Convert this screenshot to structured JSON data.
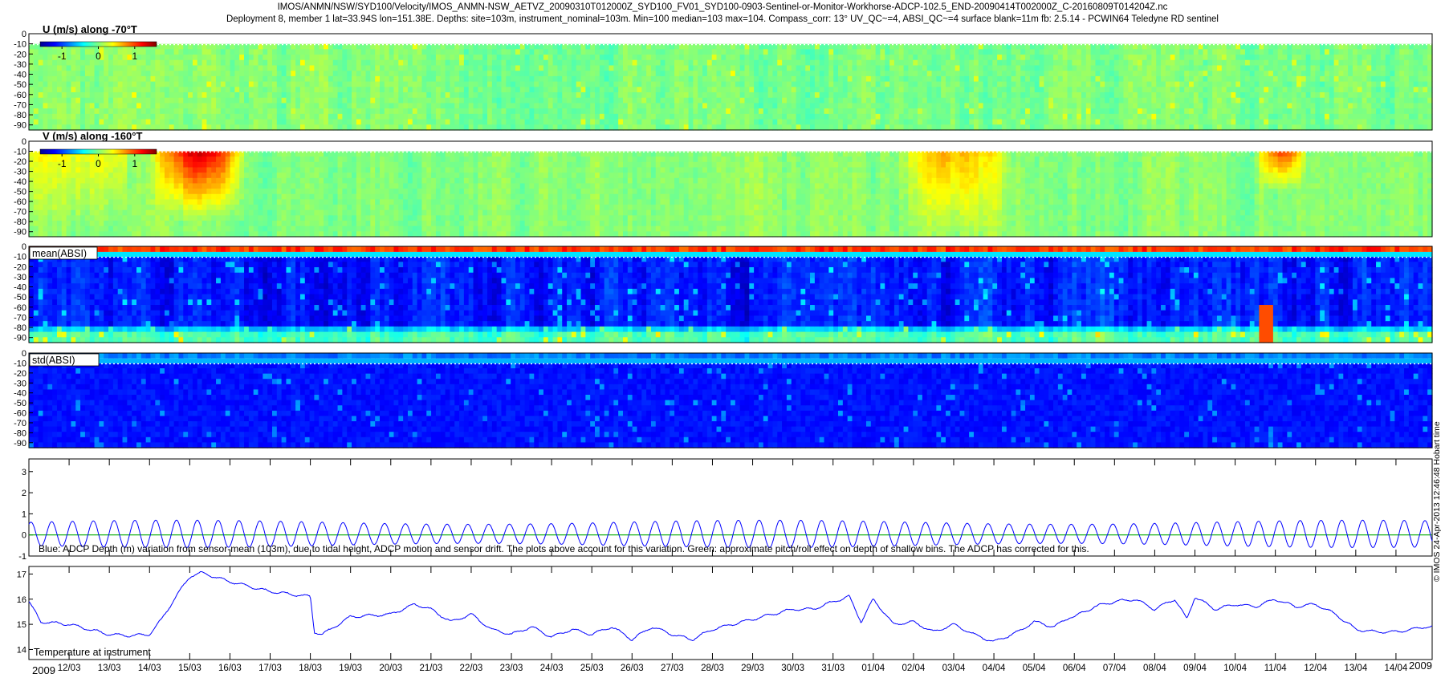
{
  "header": {
    "line1": "IMOS/ANMN/NSW/SYD100/Velocity/IMOS_ANMN-NSW_AETVZ_20090310T012000Z_SYD100_FV01_SYD100-0903-Sentinel-or-Monitor-Workhorse-ADCP-102.5_END-20090414T002000Z_C-20160809T014204Z.nc",
    "line2": "Deployment 8, member 1 lat=33.94S lon=151.38E. Depths: site=103m, instrument_nominal=103m. Min=100 median=103 max=104. Compass_corr: 13° UV_QC~=4, ABSI_QC~=4 surface blank=11m fb: 2.5.14 - PCWIN64 Teledyne RD sentinel"
  },
  "side_label": "© IMOS 24-Apr-2013 12:46:48 Hobart time",
  "colors": {
    "line_blue": "#0000ff",
    "line_green": "#00aa00",
    "jet_dark_blue": "#00008f",
    "jet_green": "#40d040",
    "jet_orange": "#e07000"
  },
  "chart_data": [
    {
      "type": "heatmap",
      "title": "U (m/s) along -70°T",
      "ylim": [
        -95,
        0
      ],
      "yticks": [
        0,
        -10,
        -20,
        -30,
        -40,
        -50,
        -60,
        -70,
        -80,
        -90
      ],
      "colorbar": {
        "colormap": "jet",
        "range": [
          -1.6,
          1.6
        ],
        "ticks": [
          -1,
          0,
          1
        ],
        "tick_labels": [
          "-1",
          "0",
          "1"
        ]
      }
    },
    {
      "type": "heatmap",
      "title": "V (m/s) along -160°T",
      "ylim": [
        -95,
        0
      ],
      "yticks": [
        0,
        -10,
        -20,
        -30,
        -40,
        -50,
        -60,
        -70,
        -80,
        -90
      ],
      "colorbar": {
        "colormap": "jet",
        "range": [
          -1.6,
          1.6
        ],
        "ticks": [
          -1,
          0,
          1
        ],
        "tick_labels": [
          "-1",
          "0",
          "1"
        ]
      },
      "hotspots": [
        {
          "day_from": 3.0,
          "day_to": 5.5,
          "depth_from": -10,
          "depth_to": -60,
          "value": 1.3
        },
        {
          "day_from": 21.5,
          "day_to": 24.5,
          "depth_from": -10,
          "depth_to": -80,
          "value": 0.6
        },
        {
          "day_from": 30.5,
          "day_to": 31.8,
          "depth_from": -10,
          "depth_to": -30,
          "value": 1.0
        }
      ]
    },
    {
      "type": "heatmap",
      "title": "mean(ABSI)",
      "ylim": [
        -95,
        0
      ],
      "yticks": [
        0,
        -10,
        -20,
        -30,
        -40,
        -50,
        -60,
        -70,
        -80,
        -90
      ]
    },
    {
      "type": "heatmap",
      "title": "std(ABSI)",
      "ylim": [
        -95,
        0
      ],
      "yticks": [
        0,
        -10,
        -20,
        -30,
        -40,
        -50,
        -60,
        -70,
        -80,
        -90
      ]
    },
    {
      "type": "line",
      "annotation": "Blue: ADCP Depth (m) variation from sensor-mean (103m), due to tidal height, ADCP motion and sensor drift. The plots above account for this variation. Green: approximate pitch/roll effect on depth of shallow bins. The ADCP has corrected for this.",
      "ylim": [
        -1,
        3.6
      ],
      "yticks": [
        -1,
        0,
        1,
        2,
        3
      ],
      "series": [
        {
          "color": "#0000ff",
          "model": "semi-diurnal tide",
          "amplitude_m": 0.65,
          "offset_m": 0.05,
          "period_days": 0.5175
        },
        {
          "color": "#00aa00",
          "model": "constant",
          "value_m": 0.0
        }
      ]
    },
    {
      "type": "line",
      "annotation": "Temperature at instrument",
      "ylim": [
        13.6,
        17.3
      ],
      "yticks": [
        14,
        15,
        16,
        17
      ],
      "series": [
        {
          "color": "#0000ff",
          "x": [
            0,
            0.3,
            1,
            1.5,
            2,
            2.5,
            3,
            3.3,
            3.7,
            4,
            4.3,
            4.6,
            5,
            5.5,
            6,
            6.5,
            7,
            7.1,
            7.3,
            8,
            9,
            9.6,
            10,
            10.5,
            11,
            11.5,
            12,
            12.5,
            13,
            13.5,
            14,
            14.5,
            15,
            15.5,
            16,
            16.5,
            17,
            17.5,
            18,
            18.5,
            19,
            19.5,
            20,
            20.4,
            20.7,
            21,
            21.5,
            22,
            22.5,
            23,
            23.5,
            24,
            24.3,
            24.6,
            25,
            25.5,
            25.9,
            26,
            26.5,
            27,
            27.5,
            28,
            28.5,
            28.8,
            29,
            29.5,
            30,
            30.5,
            31,
            31.5,
            32,
            32.5,
            33,
            33.5,
            34,
            34.4,
            34.7
          ],
          "y": [
            15.9,
            15.1,
            15.0,
            14.8,
            14.6,
            14.55,
            14.6,
            15.2,
            16.2,
            16.9,
            17.05,
            16.9,
            16.7,
            16.5,
            16.3,
            16.2,
            16.1,
            14.7,
            14.6,
            15.3,
            15.4,
            15.8,
            15.6,
            15.1,
            15.4,
            14.8,
            14.6,
            14.9,
            14.5,
            14.8,
            14.6,
            14.9,
            14.4,
            14.9,
            14.6,
            14.4,
            14.8,
            15.0,
            15.2,
            15.4,
            15.6,
            15.6,
            15.9,
            16.1,
            15.1,
            16.0,
            15.0,
            15.1,
            14.7,
            15.0,
            14.6,
            14.3,
            14.5,
            14.7,
            15.1,
            14.9,
            15.3,
            15.3,
            15.7,
            15.9,
            16.0,
            15.6,
            16.0,
            15.2,
            16.1,
            15.6,
            15.8,
            15.7,
            16.0,
            15.7,
            15.8,
            15.4,
            14.8,
            14.7,
            14.7,
            14.8,
            14.9
          ]
        }
      ]
    }
  ],
  "time_axis": {
    "range_days": [
      0,
      34.9
    ],
    "year_label_left": "2009",
    "year_label_right": "2009",
    "ticks": [
      {
        "day": 1,
        "label": "12/03"
      },
      {
        "day": 2,
        "label": "13/03"
      },
      {
        "day": 3,
        "label": "14/03"
      },
      {
        "day": 4,
        "label": "15/03"
      },
      {
        "day": 5,
        "label": "16/03"
      },
      {
        "day": 6,
        "label": "17/03"
      },
      {
        "day": 7,
        "label": "18/03"
      },
      {
        "day": 8,
        "label": "19/03"
      },
      {
        "day": 9,
        "label": "20/03"
      },
      {
        "day": 10,
        "label": "21/03"
      },
      {
        "day": 11,
        "label": "22/03"
      },
      {
        "day": 12,
        "label": "23/03"
      },
      {
        "day": 13,
        "label": "24/03"
      },
      {
        "day": 14,
        "label": "25/03"
      },
      {
        "day": 15,
        "label": "26/03"
      },
      {
        "day": 16,
        "label": "27/03"
      },
      {
        "day": 17,
        "label": "28/03"
      },
      {
        "day": 18,
        "label": "29/03"
      },
      {
        "day": 19,
        "label": "30/03"
      },
      {
        "day": 20,
        "label": "31/03"
      },
      {
        "day": 21,
        "label": "01/04"
      },
      {
        "day": 22,
        "label": "02/04"
      },
      {
        "day": 23,
        "label": "03/04"
      },
      {
        "day": 24,
        "label": "04/04"
      },
      {
        "day": 25,
        "label": "05/04"
      },
      {
        "day": 26,
        "label": "06/04"
      },
      {
        "day": 27,
        "label": "07/04"
      },
      {
        "day": 28,
        "label": "08/04"
      },
      {
        "day": 29,
        "label": "09/04"
      },
      {
        "day": 30,
        "label": "10/04"
      },
      {
        "day": 31,
        "label": "11/04"
      },
      {
        "day": 32,
        "label": "12/04"
      },
      {
        "day": 33,
        "label": "13/04"
      },
      {
        "day": 34,
        "label": "14/04"
      }
    ]
  }
}
